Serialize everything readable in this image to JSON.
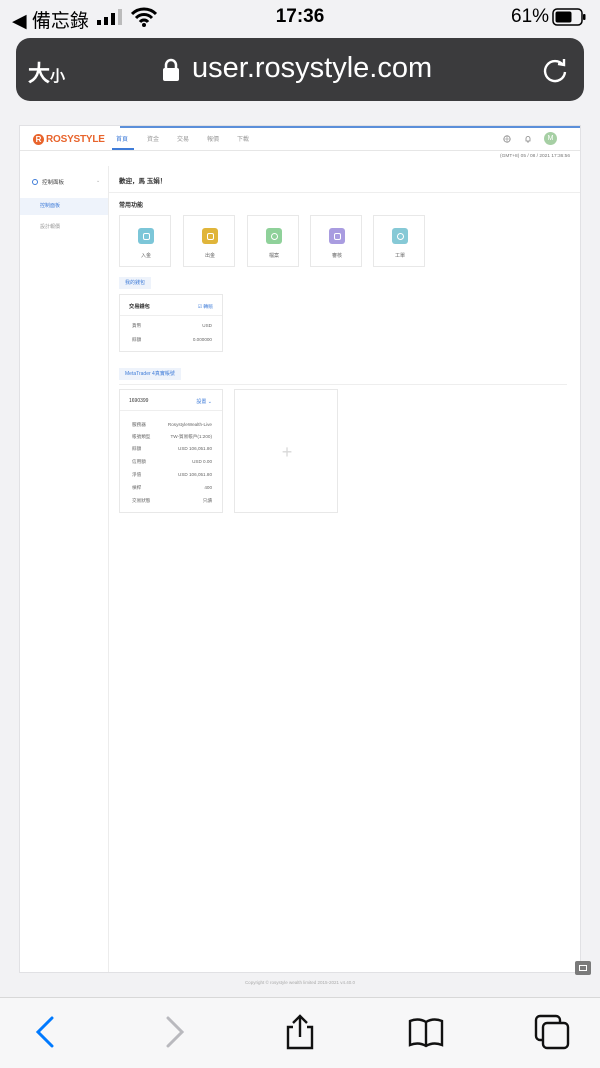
{
  "status_bar": {
    "back_app": "◀ 備忘錄",
    "time": "17:36",
    "battery": "61%"
  },
  "browser": {
    "text_size": "大",
    "text_size_small": "小",
    "url": "user.rosystyle.com"
  },
  "site": {
    "logo_mark": "R",
    "logo": "ROSYSTYLE",
    "nav": [
      "首頁",
      "資金",
      "交易",
      "報價",
      "下載"
    ],
    "avatar": "M",
    "datetime": "(GMT+8) 05 / 08 / 2021 17:36:56"
  },
  "sidebar": {
    "heading": "控制面板",
    "items": [
      "控制面板",
      "設計報價"
    ]
  },
  "main": {
    "welcome": "歡迎，馬 玉娟！",
    "quick_title": "常用功能",
    "quick": [
      {
        "label": "入金",
        "color": "#7cc6d8"
      },
      {
        "label": "出金",
        "color": "#e0b53a"
      },
      {
        "label": "檔案",
        "color": "#8fd19a"
      },
      {
        "label": "審核",
        "color": "#a99ce0"
      },
      {
        "label": "工單",
        "color": "#86c9d6"
      }
    ]
  },
  "wallet": {
    "tab": "我的錢包",
    "title": "交易錢包",
    "link": "轉賬",
    "rows": [
      {
        "k": "貨幣",
        "v": "USD"
      },
      {
        "k": "餘額",
        "v": "0.000000"
      }
    ]
  },
  "mt4": {
    "tab": "MetaTrader 4真實帳號",
    "account": "1690399",
    "settings": "設置",
    "rows": [
      {
        "k": "服務器",
        "v": "RosystyleWealth-Live"
      },
      {
        "k": "帳號類型",
        "v": "TW-貿易帳戶(1:200)"
      },
      {
        "k": "餘額",
        "v": "USD 106,051.80"
      },
      {
        "k": "信用額",
        "v": "USD 0.00"
      },
      {
        "k": "淨值",
        "v": "USD 106,051.80"
      },
      {
        "k": "槓桿",
        "v": "400"
      },
      {
        "k": "交易狀態",
        "v": "只讀"
      }
    ],
    "add": "+"
  },
  "footer": {
    "copyright": "Copyright © rosystyle wealth limited 2015-2021 v4.40.0"
  }
}
